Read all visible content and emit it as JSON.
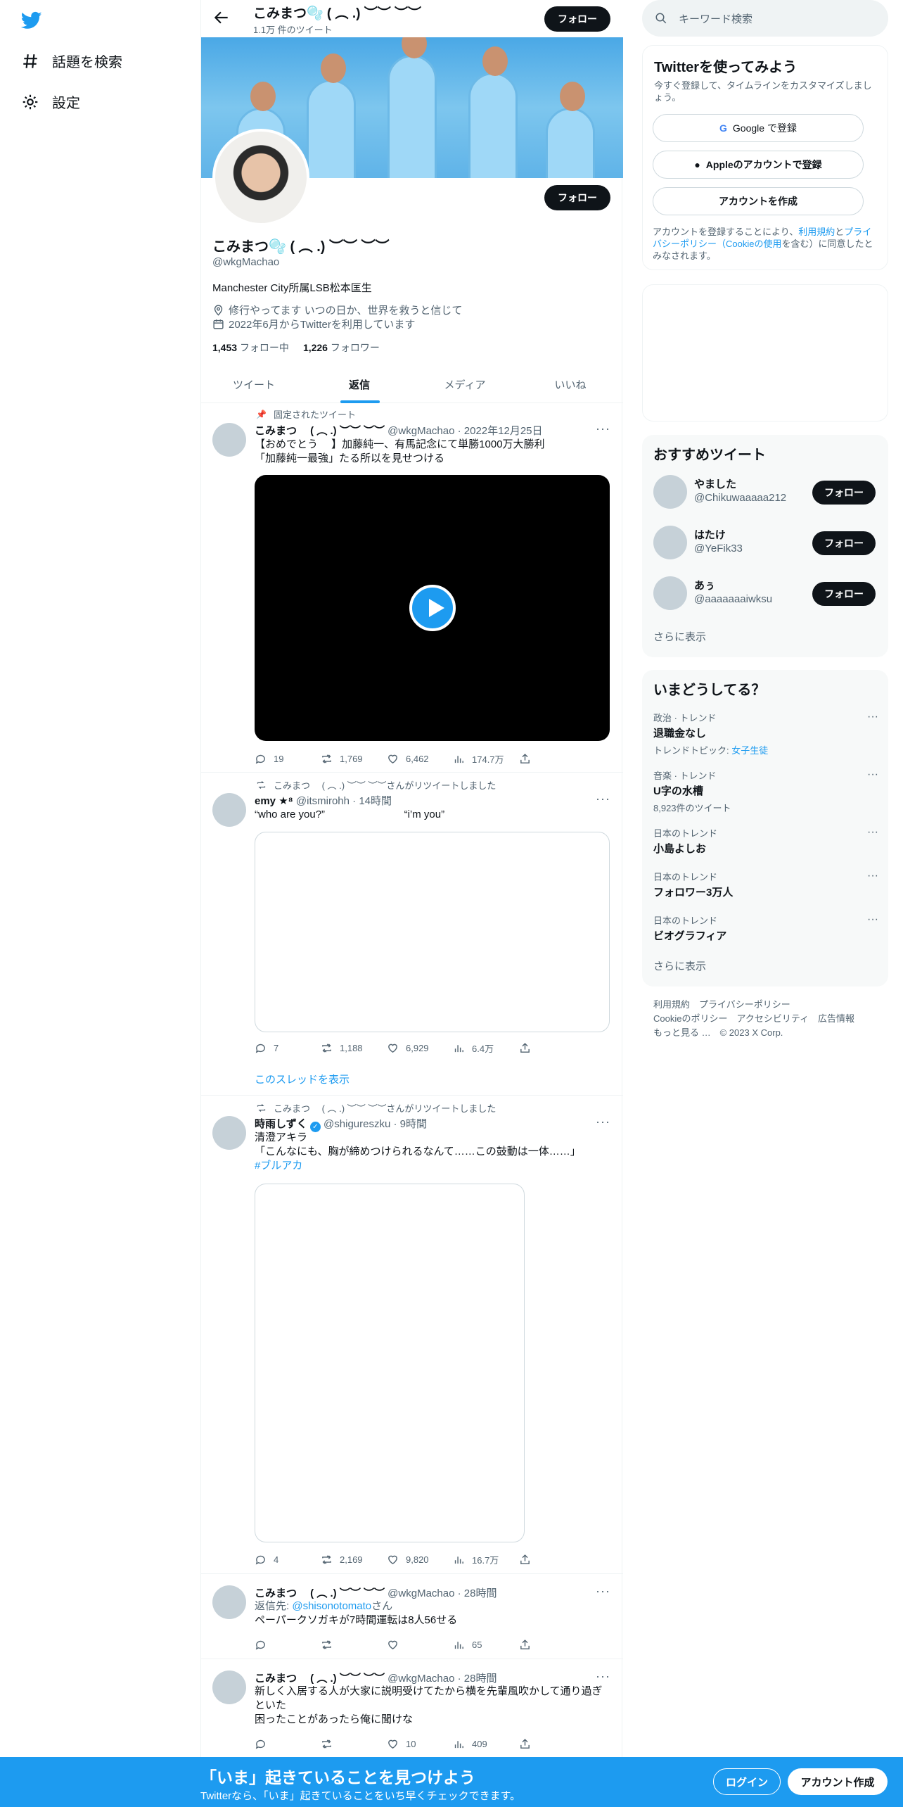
{
  "nav": {
    "search_label": "話題を検索",
    "settings_label": "設定"
  },
  "header": {
    "name": "こみまつ🫧 ( ︵ .) ︶︶ ︶︶",
    "tweet_count": "1.1万 件のツイート",
    "follow_label": "フォロー"
  },
  "profile": {
    "name": "こみまつ🫧 ( ︵ .) ︶︶ ︶︶",
    "handle": "@wkgMachao",
    "bio": "Manchester City所属LSB松本匡生",
    "location": "修行やってます いつの日か、世界を救うと信じて",
    "joined": "2022年6月からTwitterを利用しています",
    "following_count": "1,453",
    "following_label": "フォロー中",
    "followers_count": "1,226",
    "followers_label": "フォロワー",
    "follow_label": "フォロー"
  },
  "tabs": [
    {
      "label": "ツイート"
    },
    {
      "label": "返信"
    },
    {
      "label": "メディア"
    },
    {
      "label": "いいね"
    }
  ],
  "tweets": [
    {
      "pinned": "固定されたツイート",
      "name": "こみまつ　 ( ︵ .) ︶︶ ︶︶",
      "meta": "@wkgMachao · 2022年12月25日",
      "text": "【おめでとう　 】加藤純一、有馬記念にて単勝1000万大勝利\n「加藤純一最強」たる所以を見せつける",
      "replies": "19",
      "retweets": "1,769",
      "likes": "6,462",
      "views": "174.7万"
    },
    {
      "retweeted_by": "こみまつ　 ( ︵ .) ︶︶ ︶︶さんがリツイートしました",
      "name": "emy ★⁸",
      "meta": "@itsmirohh · 14時間",
      "text": "“who are you?”                           “i’m you”",
      "replies": "7",
      "retweets": "1,188",
      "likes": "6,929",
      "views": "6.4万",
      "thread": "このスレッドを表示"
    },
    {
      "retweeted_by": "こみまつ　 ( ︵ .) ︶︶ ︶︶さんがリツイートしました",
      "name": "時雨しずく",
      "meta": "@shigureszku · 9時間",
      "text": "清澄アキラ\n「こんなにも、胸が締めつけられるなんて……この鼓動は一体……」",
      "hashtag": "#ブルアカ",
      "replies": "4",
      "retweets": "2,169",
      "likes": "9,820",
      "views": "16.7万"
    },
    {
      "name": "こみまつ　 ( ︵ .) ︶︶ ︶︶",
      "meta": "@wkgMachao · 28時間",
      "reply_prefix": "返信先: ",
      "reply_to": "@shisonotomato",
      "reply_suffix": "さん",
      "text": "ペーパークソガキが7時間運転は8人56せる",
      "views": "65"
    },
    {
      "name": "こみまつ　 ( ︵ .) ︶︶ ︶︶",
      "meta": "@wkgMachao · 28時間",
      "text": "新しく入居する人が大家に説明受けてたから横を先輩風吹かして通り過ぎといた\n困ったことがあったら俺に聞けな",
      "likes": "10",
      "views": "409"
    }
  ],
  "right": {
    "search_placeholder": "キーワード検索",
    "signup": {
      "title": "Twitterを使ってみよう",
      "subtitle": "今すぐ登録して、タイムラインをカスタマイズしましょう。",
      "google": "Google で登録",
      "apple": "Appleのアカウントで登録",
      "create": "アカウントを作成",
      "terms_1": "アカウントを登録することにより、",
      "terms_link1": "利用規約",
      "terms_2": "と",
      "terms_link2": "プライバシーポリシー（Cookieの使用",
      "terms_3": "を含む）に同意したとみなされます。"
    },
    "who_to_follow": {
      "title": "おすすめツイート",
      "users": [
        {
          "name": "やました",
          "handle": "@Chikuwaaaaa212"
        },
        {
          "name": "はたけ",
          "handle": "@YeFik33"
        },
        {
          "name": "あぅ",
          "handle": "@aaaaaaaiwksu"
        }
      ],
      "follow_label": "フォロー",
      "show_more": "さらに表示"
    },
    "trends": {
      "title": "いまどうしてる？",
      "items": [
        {
          "category": "政治 · トレンド",
          "title": "退職金なし",
          "sub_prefix": "トレンドトピック: ",
          "sub_link": "女子生徒"
        },
        {
          "category": "音楽 · トレンド",
          "title": "U字の水槽",
          "sub": "8,923件のツイート"
        },
        {
          "category": "日本のトレンド",
          "title": "小島よしお"
        },
        {
          "category": "日本のトレンド",
          "title": "フォロワー3万人"
        },
        {
          "category": "日本のトレンド",
          "title": "ビオグラフィア"
        }
      ],
      "show_more": "さらに表示"
    },
    "footer": {
      "line1": "利用規約　プライバシーポリシー",
      "line2": "Cookieのポリシー　アクセシビリティ　広告情報",
      "line3": "もっと見る …　© 2023 X Corp."
    }
  },
  "bottom": {
    "title": "「いま」起きていることを見つけよう",
    "subtitle": "Twitterなら、「いま」起きていることをいち早くチェックできます。",
    "login": "ログイン",
    "signup": "アカウント作成"
  }
}
